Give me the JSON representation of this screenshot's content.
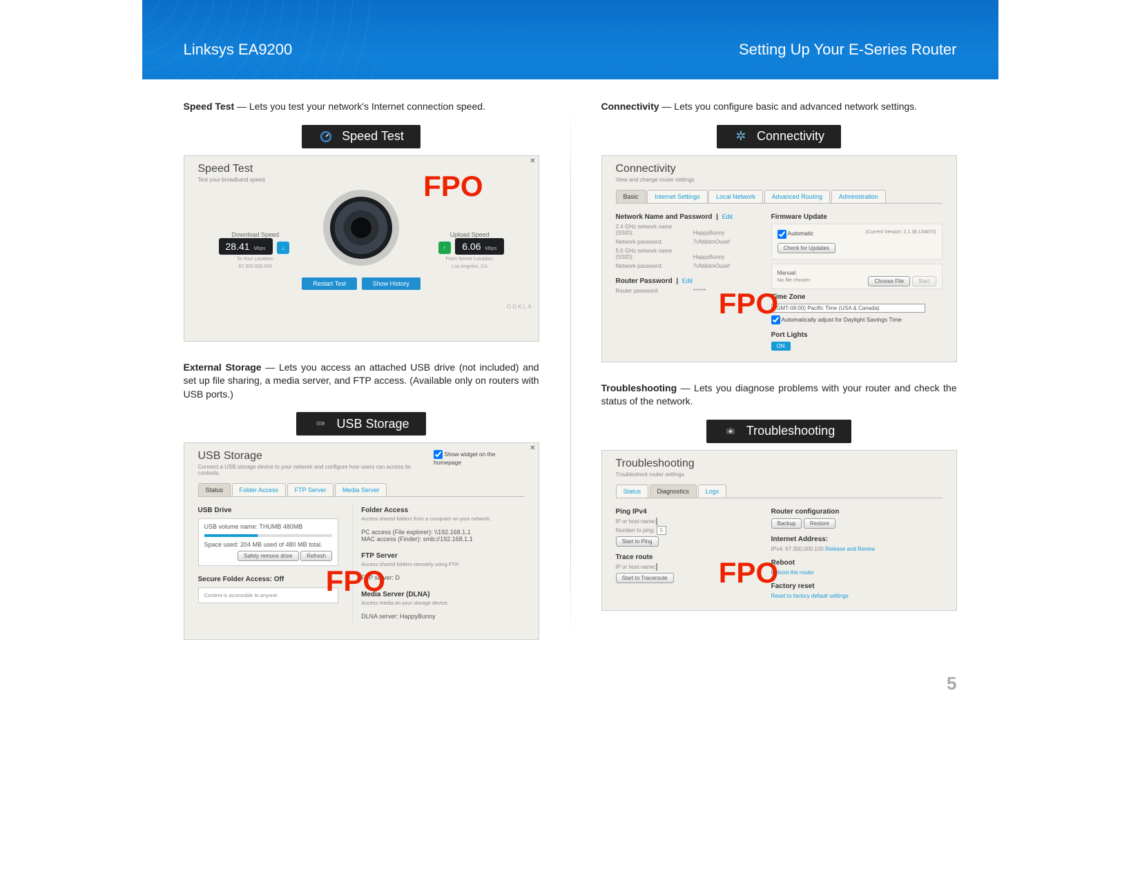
{
  "header": {
    "product": "Linksys EA9200",
    "chapter": "Setting Up Your E-Series Router"
  },
  "page_number": "5",
  "fpo": "FPO",
  "sections": {
    "speed": {
      "name": "Speed Test",
      "desc": " — Lets you test your network's Internet connection speed.",
      "widget_title": "Speed Test",
      "panel_title": "Speed Test",
      "panel_sub": "Test your broadband speed.",
      "download_label": "Download Speed",
      "download_value": "28.41",
      "download_unit": "Mbps",
      "download_loc_label": "To Your Location:",
      "download_loc": "67.300.000.000",
      "upload_label": "Upload Speed",
      "upload_value": "6.06",
      "upload_unit": "Mbps",
      "upload_loc_label": "From Server Location:",
      "upload_loc": "Los Angeles, CA",
      "restart_btn": "Restart Test",
      "history_btn": "Show History",
      "ookla": "OOKLA"
    },
    "storage": {
      "name": "External Storage",
      "desc": " — Lets you access an attached USB drive (not included) and set up file sharing, a media server, and FTP access. (Available only on routers with USB ports.)",
      "widget_title": "USB Storage",
      "panel_title": "USB Storage",
      "panel_sub": "Connect a USB storage device to your network and configure how users can access its contents.",
      "homepage_chk": "Show widget on the homepage",
      "tabs": {
        "status": "Status",
        "folder": "Folder Access",
        "ftp": "FTP Server",
        "media": "Media Server"
      },
      "drive_h": "USB Drive",
      "volume": "USB volume name: THUMB 480MB",
      "space": "Space used: 204 MB used of 480 MB total.",
      "safely_btn": "Safely remove drive",
      "refresh_btn": "Refresh",
      "secure_h": "Secure Folder Access: Off",
      "secure_sub": "Content is accessible to anyone.",
      "folder_h": "Folder Access",
      "folder_sub": "Access shared folders from a computer on your network.",
      "pc_access": "PC access (File explorer): \\\\192.168.1.1",
      "mac_access": "MAC access (Finder): smb://192.168.1.1",
      "ftp_h": "FTP Server",
      "ftp_sub": "Access shared folders remotely using FTP.",
      "ftp_server": "FTP server: D",
      "media_h": "Media Server (DLNA)",
      "media_sub": "Access media on your storage device.",
      "dlna": "DLNA server: HappyBunny"
    },
    "conn": {
      "name": "Connectivity",
      "desc": " — Lets you configure basic and advanced network settings.",
      "widget_title": "Connectivity",
      "panel_title": "Connectivity",
      "panel_sub": "View and change router settings",
      "tabs": {
        "basic": "Basic",
        "internet": "Internet Settings",
        "local": "Local Network",
        "routing": "Advanced Routing",
        "admin": "Administration"
      },
      "net_name_h": "Network Name and Password",
      "edit": "Edit",
      "ssid24_label": "2.4 GHz network name (SSID):",
      "ssid24": "HappyBunny",
      "pw_label": "Network password:",
      "pw_val": "7rAbbitmOusef",
      "ssid50_label": "5.0 GHz network name (SSID):",
      "ssid50": "HappyBunny",
      "router_pw_h": "Router Password",
      "router_pw_label": "Router password:",
      "router_pw_val": "******",
      "fw_h": "Firmware Update",
      "auto": "Automatic",
      "fw_ver": "(Current Version: 2.1.38.134870)",
      "check_btn": "Check for Updates",
      "manual_h": "Manual:",
      "manual_sub": "No file chosen",
      "choose_btn": "Choose File",
      "start_btn": "Start",
      "tz_h": "Time Zone",
      "tz_val": "(GMT-08:00) Pacific Time (USA & Canada)",
      "dst": "Automatically adjust for Daylight Savings Time",
      "lights_h": "Port Lights",
      "on": "ON"
    },
    "trouble": {
      "name": "Troubleshooting",
      "desc": " — Lets you diagnose problems with your router and check the status of the network.",
      "widget_title": "Troubleshooting",
      "panel_title": "Troubleshooting",
      "panel_sub": "Troubleshoot router settings",
      "tabs": {
        "status": "Status",
        "diag": "Diagnostics",
        "logs": "Logs"
      },
      "ping_h": "Ping IPv4",
      "ip_label": "IP or host name:",
      "num_label": "Number to ping:",
      "num_val": "5",
      "ping_btn": "Start to Ping",
      "trace_h": "Trace route",
      "trace_btn": "Start to Traceroute",
      "cfg_h": "Router configuration",
      "backup_btn": "Backup",
      "restore_btn": "Restore",
      "inet_h": "Internet Address:",
      "inet_val": "IPv4: 67.300.000.100",
      "release": "Release and Renew",
      "reboot_h": "Reboot",
      "reboot_link": "Reboot the router",
      "factory_h": "Factory reset",
      "factory_link": "Reset to factory default settings"
    }
  }
}
